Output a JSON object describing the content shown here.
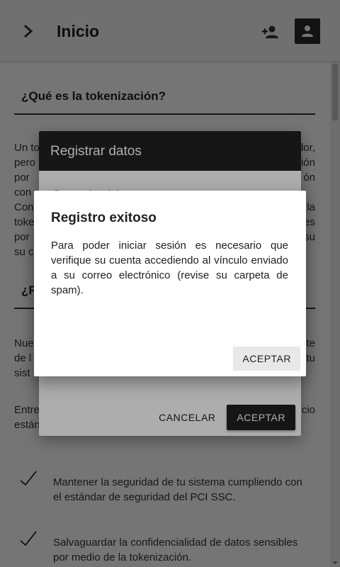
{
  "app_bar": {
    "title": "Inicio",
    "menu_icon": "chevron-right-icon",
    "register_icon": "person-add-icon",
    "account_icon": "person-icon"
  },
  "content": {
    "section1_title": "¿Qué es la tokenización?",
    "section1_lines": [
      "Un to",
      "pero",
      "por",
      "con",
      "Con",
      "toke",
      "por",
      "su con"
    ],
    "section1_right": [
      "dor,",
      "ión",
      "ón",
      "",
      "la",
      "es",
      "su"
    ],
    "section2_title": "¿P",
    "para2_left": [
      "Nue",
      "de l",
      "sist"
    ],
    "para2_right": [
      "te",
      "tu"
    ],
    "para3_left": [
      "Entre",
      "están"
    ],
    "para3_right": [
      "cio"
    ],
    "checklist": [
      "Mantener la seguridad de tu sistema cumpliendo con el estándar de seguridad del PCI SSC.",
      "Salvaguardar la confidencialidad de datos sensibles por medio de la tokenización."
    ]
  },
  "dialog_register": {
    "title": "Registrar datos",
    "field_label": "Correo electrónico",
    "cancel_label": "CANCELAR",
    "accept_label": "ACEPTAR"
  },
  "dialog_success": {
    "title": "Registro exitoso",
    "body": "Para poder iniciar sesión es necesario que verifique su cuenta accediendo al vínculo enviado a su correo electrónico (revise su carpeta de spam).",
    "accept_label": "ACEPTAR"
  }
}
